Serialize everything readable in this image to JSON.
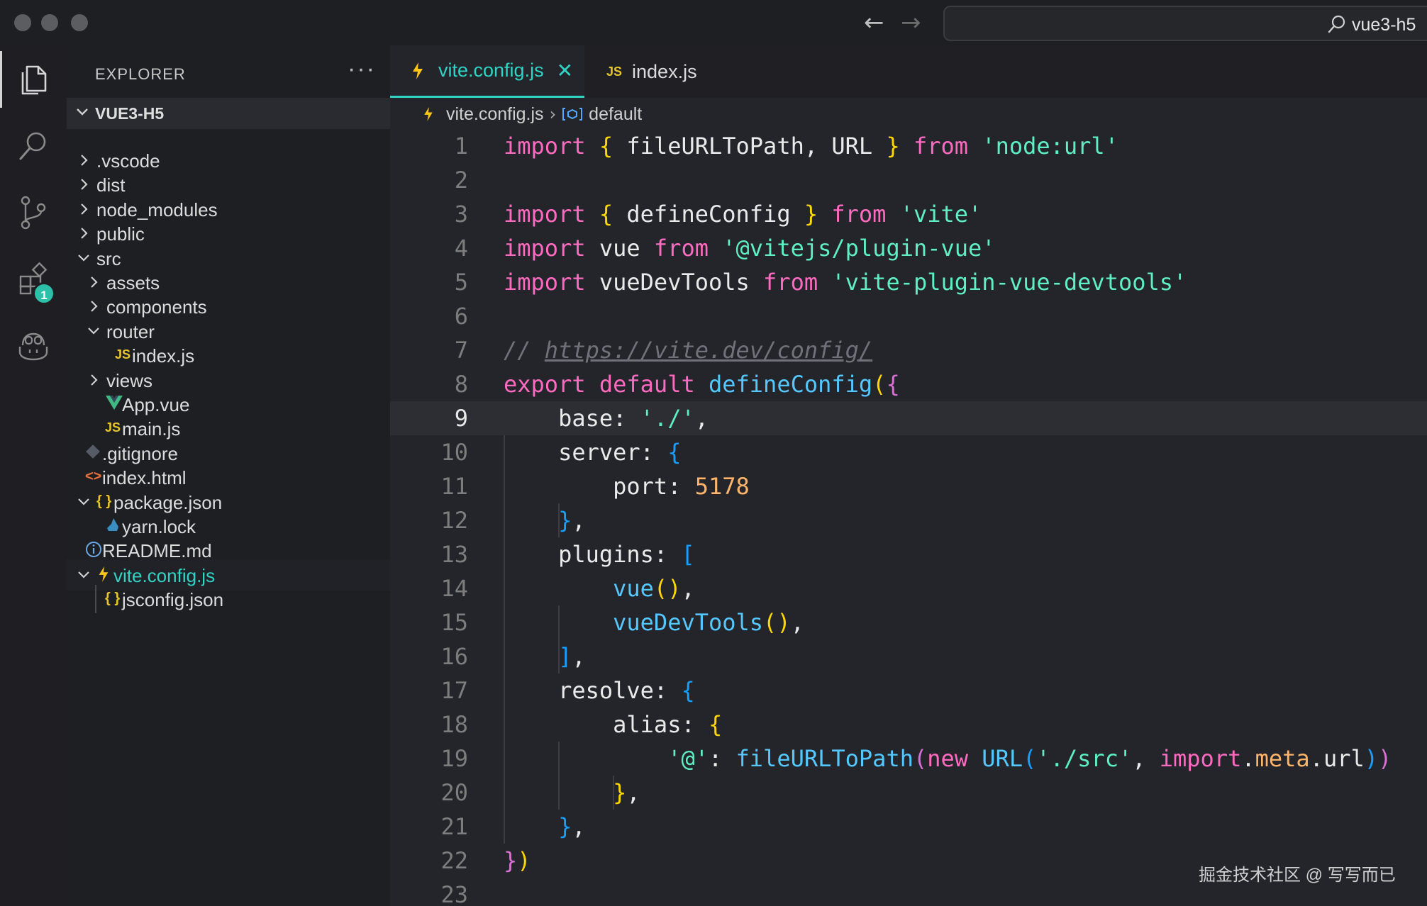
{
  "window": {
    "search_text": "vue3-h5",
    "back_label": "←",
    "forward_label": "→"
  },
  "activity_bar": {
    "items": [
      "explorer-icon",
      "search-icon",
      "source-control-icon",
      "extensions-icon",
      "copilot-icon"
    ],
    "extensions_badge": "1"
  },
  "sidebar": {
    "header": "EXPLORER",
    "more": "···",
    "project": "VUE3-H5",
    "tree": [
      {
        "label": ".vscode",
        "type": "folder",
        "expanded": false,
        "depth": 0
      },
      {
        "label": "dist",
        "type": "folder",
        "expanded": false,
        "depth": 0
      },
      {
        "label": "node_modules",
        "type": "folder",
        "expanded": false,
        "depth": 0
      },
      {
        "label": "public",
        "type": "folder",
        "expanded": false,
        "depth": 0
      },
      {
        "label": "src",
        "type": "folder",
        "expanded": true,
        "depth": 0
      },
      {
        "label": "assets",
        "type": "folder",
        "expanded": false,
        "depth": 1
      },
      {
        "label": "components",
        "type": "folder",
        "expanded": false,
        "depth": 1
      },
      {
        "label": "router",
        "type": "folder",
        "expanded": true,
        "depth": 1
      },
      {
        "label": "index.js",
        "type": "js",
        "depth": 2
      },
      {
        "label": "views",
        "type": "folder",
        "expanded": false,
        "depth": 1
      },
      {
        "label": "App.vue",
        "type": "vue",
        "depth": 1
      },
      {
        "label": "main.js",
        "type": "js",
        "depth": 1
      },
      {
        "label": ".gitignore",
        "type": "git",
        "depth": 0
      },
      {
        "label": "index.html",
        "type": "html",
        "depth": 0
      },
      {
        "label": "package.json",
        "type": "json",
        "expanded": true,
        "depth": 0
      },
      {
        "label": "yarn.lock",
        "type": "yarn",
        "depth": 1
      },
      {
        "label": "README.md",
        "type": "info",
        "depth": 0
      },
      {
        "label": "vite.config.js",
        "type": "vite",
        "expanded": true,
        "depth": 0,
        "active": true
      },
      {
        "label": "jsconfig.json",
        "type": "json",
        "depth": 1
      }
    ],
    "file_icon_glyphs": {
      "js": "JS",
      "json": "{ }",
      "html": "<>",
      "info": "i"
    }
  },
  "editor": {
    "tabs": [
      {
        "label": "vite.config.js",
        "active": true,
        "close": "✕"
      },
      {
        "label": "index.js",
        "active": false
      }
    ],
    "breadcrumb": {
      "file": "vite.config.js",
      "separator": "›",
      "symbol": "default"
    },
    "current_line": 9,
    "lines": [
      "import { fileURLToPath, URL } from 'node:url'",
      "",
      "import { defineConfig } from 'vite'",
      "import vue from '@vitejs/plugin-vue'",
      "import vueDevTools from 'vite-plugin-vue-devtools'",
      "",
      "// https://vite.dev/config/",
      "export default defineConfig({",
      "  base: './',",
      "  server: {",
      "    port: 5178",
      "  },",
      "  plugins: [",
      "    vue(),",
      "    vueDevTools(),",
      "  ],",
      "  resolve: {",
      "    alias: {",
      "      '@': fileURLToPath(new URL('./src', import.meta.url))",
      "    },",
      "  },",
      "})",
      ""
    ]
  },
  "watermark": "掘金技术社区 @ 写写而已",
  "colors": {
    "accent": "#2fd4c4",
    "keyword": "#ff6ac1",
    "string": "#5fefc4",
    "function": "#55c7ff",
    "number": "#ffb46b",
    "comment": "#70727a",
    "badge": "#2bc0a7"
  }
}
